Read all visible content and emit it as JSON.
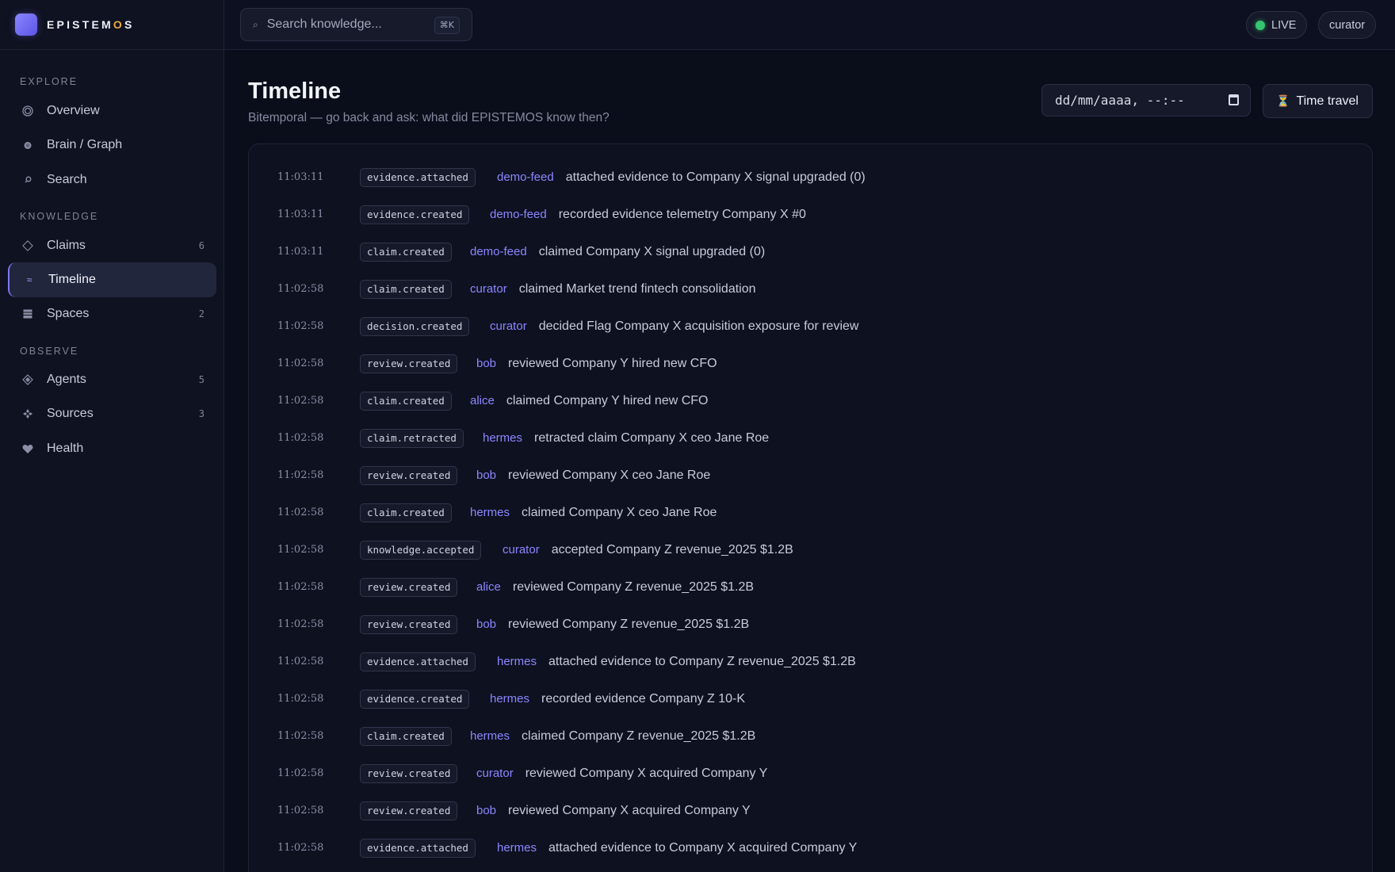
{
  "brand": {
    "name_pre": "EPISTEM",
    "name_hl": "O",
    "name_post": "S"
  },
  "search": {
    "placeholder": "Search knowledge...",
    "shortcut": "⌘K"
  },
  "status": {
    "live": "LIVE",
    "user": "curator"
  },
  "sidebar": {
    "sections": [
      "EXPLORE",
      "KNOWLEDGE",
      "OBSERVE"
    ],
    "items": [
      {
        "label": "Overview",
        "icon": "overview-icon",
        "count": ""
      },
      {
        "label": "Brain / Graph",
        "icon": "brain-icon",
        "count": ""
      },
      {
        "label": "Search",
        "icon": "search-icon",
        "count": ""
      },
      {
        "label": "Claims",
        "icon": "diamond-icon",
        "count": "6"
      },
      {
        "label": "Timeline",
        "icon": "timeline-icon",
        "count": ""
      },
      {
        "label": "Spaces",
        "icon": "grid-icon",
        "count": "2"
      },
      {
        "label": "Agents",
        "icon": "agent-icon",
        "count": "5"
      },
      {
        "label": "Sources",
        "icon": "sources-icon",
        "count": "3"
      },
      {
        "label": "Health",
        "icon": "heart-icon",
        "count": ""
      }
    ]
  },
  "page": {
    "title": "Timeline",
    "subtitle": "Bitemporal — go back and ask: what did EPISTEMOS know then?",
    "datetime_placeholder": "dd/mm/aaaa, --:--",
    "time_travel_label": "Time travel"
  },
  "events": [
    {
      "time": "11:03:11",
      "type": "evidence.attached",
      "actor": "demo-feed",
      "message": "attached evidence to Company X signal upgraded (0)"
    },
    {
      "time": "11:03:11",
      "type": "evidence.created",
      "actor": "demo-feed",
      "message": "recorded evidence telemetry Company X #0"
    },
    {
      "time": "11:03:11",
      "type": "claim.created",
      "actor": "demo-feed",
      "message": "claimed Company X signal upgraded (0)"
    },
    {
      "time": "11:02:58",
      "type": "claim.created",
      "actor": "curator",
      "message": "claimed Market trend fintech consolidation"
    },
    {
      "time": "11:02:58",
      "type": "decision.created",
      "actor": "curator",
      "message": "decided Flag Company X acquisition exposure for review"
    },
    {
      "time": "11:02:58",
      "type": "review.created",
      "actor": "bob",
      "message": "reviewed Company Y hired new CFO"
    },
    {
      "time": "11:02:58",
      "type": "claim.created",
      "actor": "alice",
      "message": "claimed Company Y hired new CFO"
    },
    {
      "time": "11:02:58",
      "type": "claim.retracted",
      "actor": "hermes",
      "message": "retracted claim Company X ceo Jane Roe"
    },
    {
      "time": "11:02:58",
      "type": "review.created",
      "actor": "bob",
      "message": "reviewed Company X ceo Jane Roe"
    },
    {
      "time": "11:02:58",
      "type": "claim.created",
      "actor": "hermes",
      "message": "claimed Company X ceo Jane Roe"
    },
    {
      "time": "11:02:58",
      "type": "knowledge.accepted",
      "actor": "curator",
      "message": "accepted Company Z revenue_2025 $1.2B"
    },
    {
      "time": "11:02:58",
      "type": "review.created",
      "actor": "alice",
      "message": "reviewed Company Z revenue_2025 $1.2B"
    },
    {
      "time": "11:02:58",
      "type": "review.created",
      "actor": "bob",
      "message": "reviewed Company Z revenue_2025 $1.2B"
    },
    {
      "time": "11:02:58",
      "type": "evidence.attached",
      "actor": "hermes",
      "message": "attached evidence to Company Z revenue_2025 $1.2B"
    },
    {
      "time": "11:02:58",
      "type": "evidence.created",
      "actor": "hermes",
      "message": "recorded evidence Company Z 10-K"
    },
    {
      "time": "11:02:58",
      "type": "claim.created",
      "actor": "hermes",
      "message": "claimed Company Z revenue_2025 $1.2B"
    },
    {
      "time": "11:02:58",
      "type": "review.created",
      "actor": "curator",
      "message": "reviewed Company X acquired Company Y"
    },
    {
      "time": "11:02:58",
      "type": "review.created",
      "actor": "bob",
      "message": "reviewed Company X acquired Company Y"
    },
    {
      "time": "11:02:58",
      "type": "evidence.attached",
      "actor": "hermes",
      "message": "attached evidence to Company X acquired Company Y"
    }
  ],
  "colors": {
    "accent": "#8c87ff",
    "live": "#35c56f",
    "background": "#0a0d1a"
  }
}
